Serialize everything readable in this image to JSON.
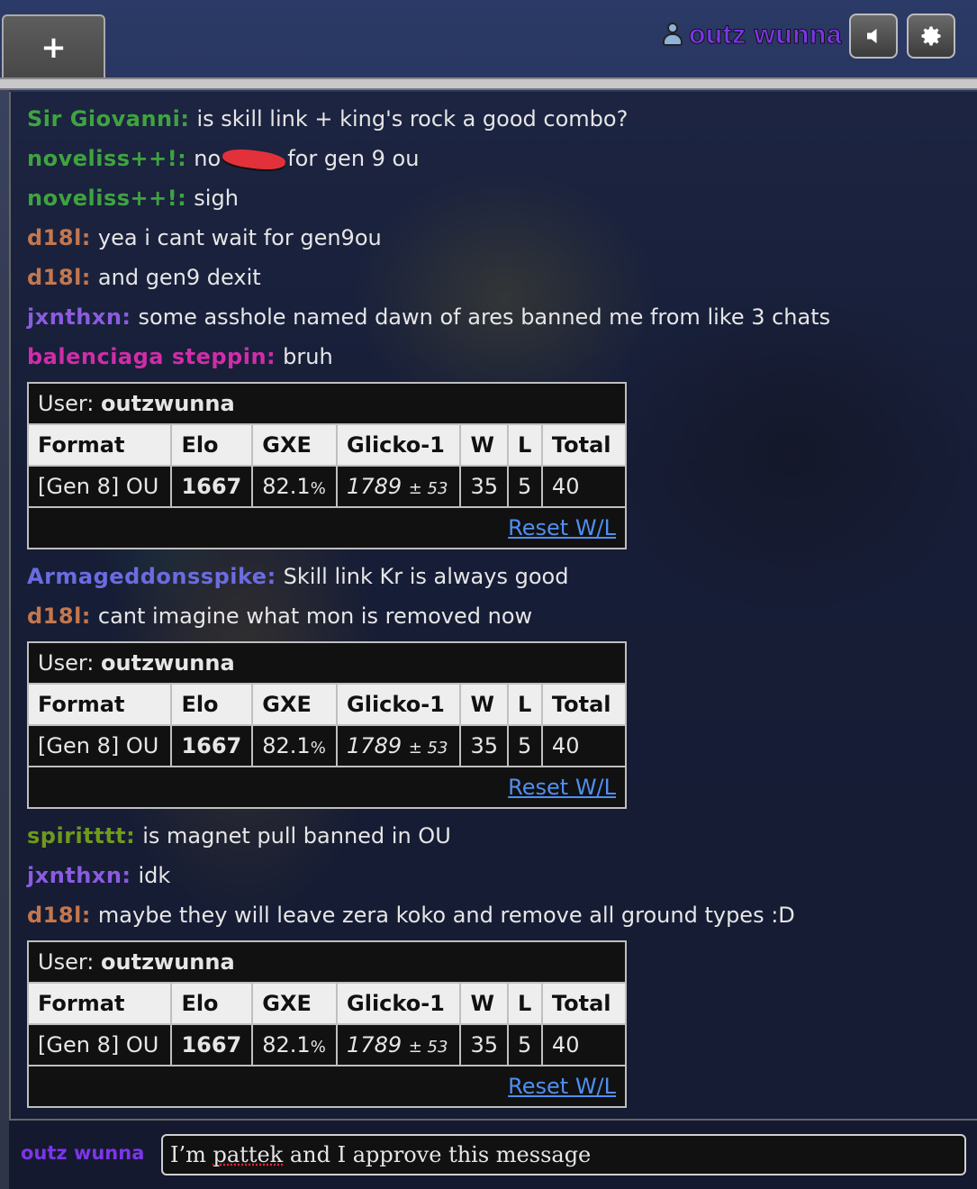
{
  "topbar": {
    "new_tab_label": "+",
    "username": "outz wunna",
    "sound_button": "sound-icon",
    "settings_button": "gear-icon"
  },
  "colors": {
    "green": "#3fa33f",
    "orange": "#c4774e",
    "purple": "#8a5ce0",
    "magenta": "#d02da8",
    "blue": "#6b6ce0",
    "olive": "#6e9a1c",
    "link": "#4f8ff0"
  },
  "messages_a": [
    {
      "user": "Sir Giovanni:",
      "text": "is skill link + king's rock a good combo?",
      "color": "#3fa33f"
    },
    {
      "user": "noveliss++!:",
      "text_before": "no",
      "text_after": "for gen 9 ou",
      "color": "#3fa33f",
      "redacted": true
    },
    {
      "user": "noveliss++!:",
      "text": "sigh",
      "color": "#3fa33f"
    },
    {
      "user": "d18l:",
      "text": "yea i cant wait for gen9ou",
      "color": "#c4774e"
    },
    {
      "user": "d18l:",
      "text": "and gen9 dexit",
      "color": "#c4774e"
    },
    {
      "user": "jxnthxn:",
      "text": "some asshole named dawn of ares banned me from like 3 chats",
      "color": "#8a5ce0"
    },
    {
      "user": "balenciaga steppin:",
      "text": "bruh",
      "color": "#d02da8"
    }
  ],
  "messages_b": [
    {
      "user": "Armageddonsspike:",
      "text": "Skill link Kr is always good",
      "color": "#6b6ce0"
    },
    {
      "user": "d18l:",
      "text": "cant imagine what mon is removed now",
      "color": "#c4774e"
    }
  ],
  "messages_c": [
    {
      "user": "spiritttt:",
      "text": "is magnet pull banned in OU",
      "color": "#6e9a1c"
    },
    {
      "user": "jxnthxn:",
      "text": "idk",
      "color": "#8a5ce0"
    },
    {
      "user": "d18l:",
      "text": "maybe they will leave zera koko and remove all ground types :D",
      "color": "#c4774e"
    }
  ],
  "rank_table": {
    "user_label": "User:",
    "user_name": "outzwunna",
    "headers": [
      "Format",
      "Elo",
      "GXE",
      "Glicko-1",
      "W",
      "L",
      "Total"
    ],
    "row": {
      "format": "[Gen 8] OU",
      "elo": "1667",
      "gxe_main": "82.1",
      "gxe_unit": "%",
      "glicko_main": "1789",
      "glicko_dev": "± 53",
      "w": "35",
      "l": "5",
      "total": "40"
    },
    "reset_label": "Reset W/L"
  },
  "input": {
    "username": "outz wunna",
    "value_before": "I’m ",
    "value_spell": "pattek",
    "value_after": " and I approve this message"
  }
}
